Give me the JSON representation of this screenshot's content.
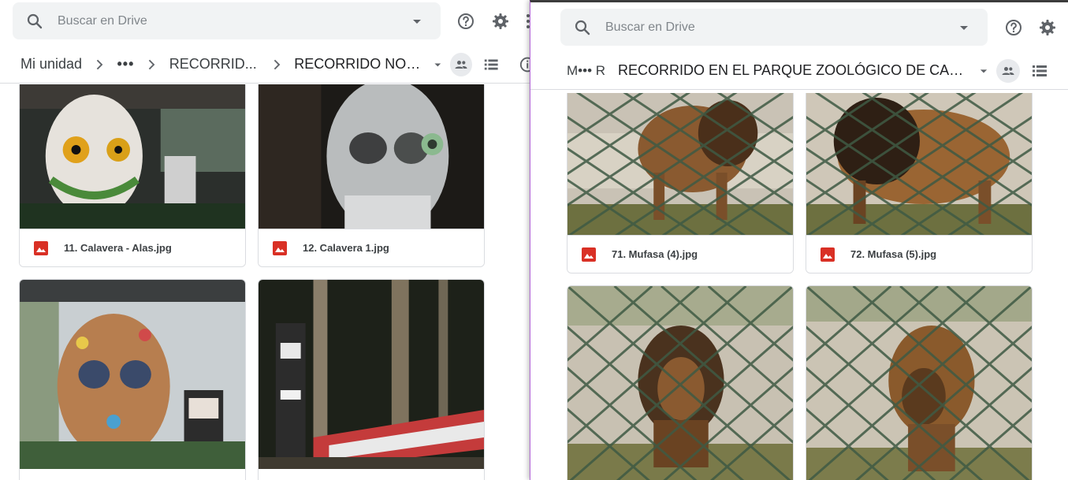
{
  "left_window": {
    "search": {
      "placeholder": "Buscar en Drive"
    },
    "breadcrumb": {
      "root": "Mi unidad",
      "ellipsis": "•••",
      "parent": "RECORRID...",
      "current": "RECORRIDO NOCT..."
    },
    "files": [
      {
        "name": "11. Calavera - Alas.jpg"
      },
      {
        "name": "12. Calavera 1.jpg"
      },
      {
        "name": ""
      },
      {
        "name": ""
      }
    ]
  },
  "right_window": {
    "search": {
      "placeholder": "Buscar en Drive"
    },
    "breadcrumb": {
      "truncated": "M••• R",
      "current": "RECORRIDO EN EL PARQUE ZOOLÓGICO DE CARIC..."
    },
    "files": [
      {
        "name": "71. Mufasa (4).jpg"
      },
      {
        "name": "72. Mufasa (5).jpg"
      },
      {
        "name": ""
      },
      {
        "name": ""
      }
    ]
  },
  "colors": {
    "image_icon": "#d93025",
    "icon_gray": "#5f6368",
    "divider": "#dadce0",
    "accent_border": "#b266d6"
  },
  "icons": [
    "search-icon",
    "dropdown-icon",
    "help-icon",
    "settings-icon",
    "more-icon",
    "chevron-right-icon",
    "shared-folder-icon",
    "list-view-icon",
    "info-icon",
    "image-file-icon"
  ]
}
